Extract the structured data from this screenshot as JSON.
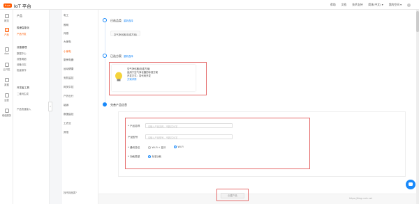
{
  "topbar": {
    "logo_badge": "tuya",
    "logo_text": "IoT 平台",
    "nav": [
      "帮助",
      "文档",
      "技术支持",
      "简体(中文) ▾",
      "我的空间 ▾"
    ]
  },
  "rail": [
    {
      "label": "概览",
      "icon": "home-icon"
    },
    {
      "label": "产品",
      "icon": "product-icon",
      "active": true
    },
    {
      "label": "App",
      "icon": "app-icon"
    },
    {
      "label": "云开发",
      "icon": "cloud-icon"
    },
    {
      "label": "数据",
      "icon": "data-icon"
    },
    {
      "label": "运营",
      "icon": "operate-icon"
    },
    {
      "label": "增值服务",
      "icon": "vas-icon"
    }
  ],
  "side": {
    "title": "产品",
    "groups": [
      {
        "label": "极速智能化",
        "links": [
          {
            "label": "产品开发",
            "active": true
          }
        ]
      },
      {
        "label": "设备管理",
        "links": [
          {
            "label": "数据中心"
          },
          {
            "label": "设备明细"
          },
          {
            "label": "设备日志"
          },
          {
            "label": "批量操作"
          }
        ]
      },
      {
        "label": "开发者工具",
        "links": [
          {
            "label": "二维码生成"
          },
          {
            "label": "产品快速接入"
          }
        ]
      }
    ]
  },
  "categories": {
    "items": [
      "电工",
      "照明",
      "传感",
      "大家电",
      "小家电",
      "厨房电器",
      "运动健康",
      "安防监控",
      "网关中控",
      "户外出行",
      "能源",
      "数据监控",
      "工农业",
      "其他"
    ],
    "active_index": 4,
    "bottom": "找不到品类?"
  },
  "steps": [
    {
      "title": "已选品类",
      "edit": "重新选择",
      "value": "空气净化器(标准方案)"
    },
    {
      "title": "已选方案",
      "edit": "重新选择"
    },
    {
      "title": "完善产品信息"
    }
  ],
  "card": {
    "name": "空气净化器(标准方案)",
    "desc": "适用于空气净化器的标准方案",
    "protocol": "开发方式：零代码开发",
    "link": "方案详情"
  },
  "form": {
    "name_label": "* 产品名称",
    "name_placeholder": "请输入产品名称，不超过20字",
    "model_label": "产品型号",
    "model_placeholder": "请输入产品型号，不超过20字",
    "protocol_label": "* 通讯协议",
    "protocol_opt1": "Wi-Fi + 蓝牙",
    "protocol_opt2": "Wi-Fi",
    "power_label": "* 功耗类型",
    "power_opt": "标准功耗"
  },
  "next_button": "创建产品",
  "watermark": "https://blog.csdn.net",
  "colors": {
    "accent": "#ff5a00",
    "link": "#1989fa",
    "highlight": "#e56b6b"
  }
}
